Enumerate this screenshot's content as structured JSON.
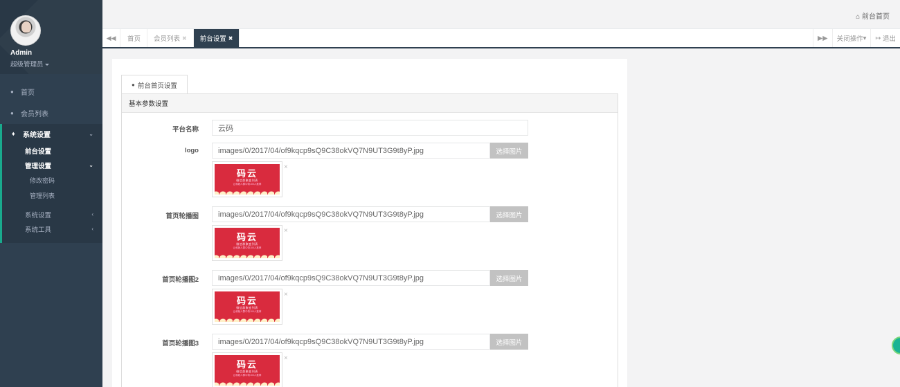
{
  "profile": {
    "name": "Admin",
    "role": "超级管理员"
  },
  "nav": {
    "home": "首页",
    "members": "会员列表",
    "system_settings": "系统设置",
    "sub": {
      "frontend": "前台设置",
      "admin_settings": "管理设置",
      "change_password": "修改密码",
      "admin_list": "管理列表",
      "system_settings2": "系统设置",
      "system_tools": "系统工具"
    }
  },
  "header": {
    "home_link": "前台首页"
  },
  "tabs": [
    {
      "label": "首页"
    },
    {
      "label": "会员列表"
    },
    {
      "label": "前台设置"
    }
  ],
  "toolbar": {
    "close_ops": "关闭操作",
    "logout": "退出"
  },
  "page": {
    "tab_label": "前台首页设置",
    "panel_title": "基本参数设置",
    "pick_label": "选择图片",
    "remove_glyph": "×",
    "banner_title": "码云",
    "banner_line1": "微信群聚变列表",
    "banner_line2": "让和她人群中背100人推荐",
    "fields": {
      "platform_name": {
        "label": "平台名称",
        "value": "云码"
      },
      "logo": {
        "label": "logo",
        "value": "images/0/2017/04/of9kqcp9sQ9C38okVQ7N9UT3G9t8yP.jpg"
      },
      "carousel1": {
        "label": "首页轮播图",
        "value": "images/0/2017/04/of9kqcp9sQ9C38okVQ7N9UT3G9t8yP.jpg"
      },
      "carousel2": {
        "label": "首页轮播图2",
        "value": "images/0/2017/04/of9kqcp9sQ9C38okVQ7N9UT3G9t8yP.jpg"
      },
      "carousel3": {
        "label": "首页轮播图3",
        "value": "images/0/2017/04/of9kqcp9sQ9C38okVQ7N9UT3G9t8yP.jpg"
      }
    }
  },
  "colors": {
    "sidebar": "#2f4050",
    "accent": "#19aa8d",
    "banner": "#d92b3e"
  }
}
